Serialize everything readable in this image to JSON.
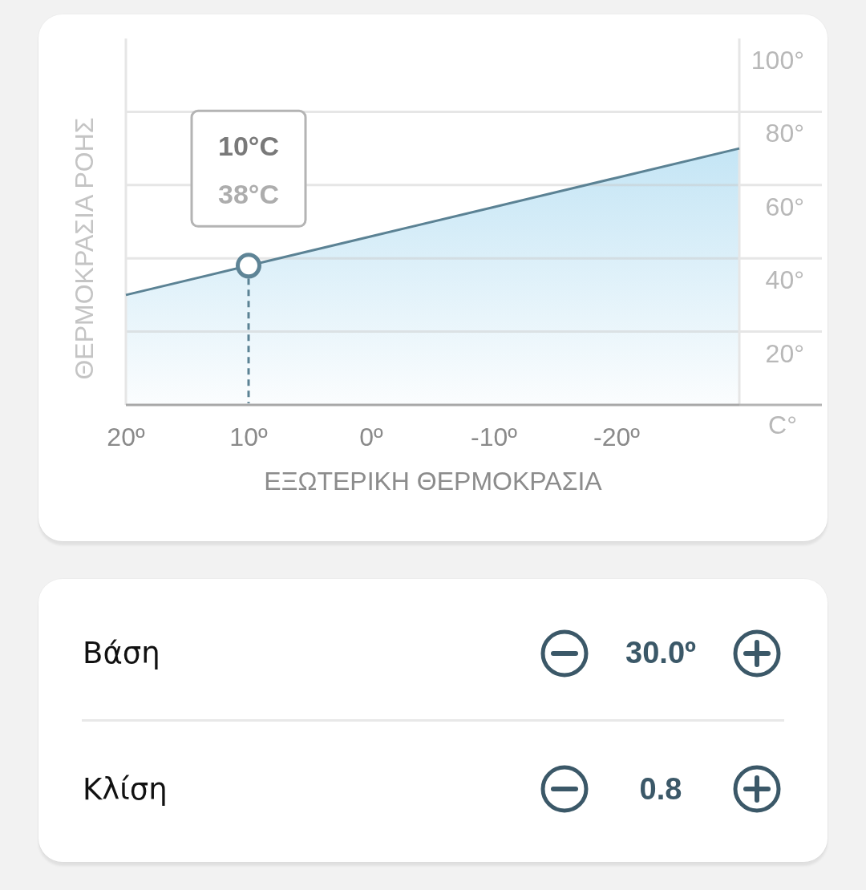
{
  "chart_card": {
    "unit": "C°",
    "chart_data": {
      "type": "area",
      "xlabel": "ΕΞΩΤΕΡΙΚΗ ΘΕΡΜΟΚΡΑΣΙΑ",
      "ylabel": "ΘΕΡΜΟΚΡΑΣΙΑ ΡΟΗΣ",
      "x": [
        20,
        10,
        0,
        -10,
        -20,
        -30
      ],
      "values": [
        30,
        38,
        46,
        54,
        62,
        70
      ],
      "xlim": [
        20,
        -30
      ],
      "ylim": [
        0,
        100
      ],
      "grid": true,
      "xticks": [
        {
          "value": 20,
          "label": "20º"
        },
        {
          "value": 10,
          "label": "10º"
        },
        {
          "value": 0,
          "label": "0º"
        },
        {
          "value": -10,
          "label": "-10º"
        },
        {
          "value": -20,
          "label": "-20º"
        }
      ],
      "yticks": [
        {
          "value": 20,
          "label": "20°"
        },
        {
          "value": 40,
          "label": "40°"
        },
        {
          "value": 60,
          "label": "60°"
        },
        {
          "value": 80,
          "label": "80°"
        },
        {
          "value": 100,
          "label": "100°"
        }
      ],
      "ref_lines": [
        {
          "axis": "x",
          "value": 10
        }
      ],
      "annotations": [
        "10°C",
        "38°C"
      ]
    }
  },
  "settings": [
    {
      "label": "Βάση",
      "value": "30.0º"
    },
    {
      "label": "Κλίση",
      "value": "0.8"
    }
  ]
}
